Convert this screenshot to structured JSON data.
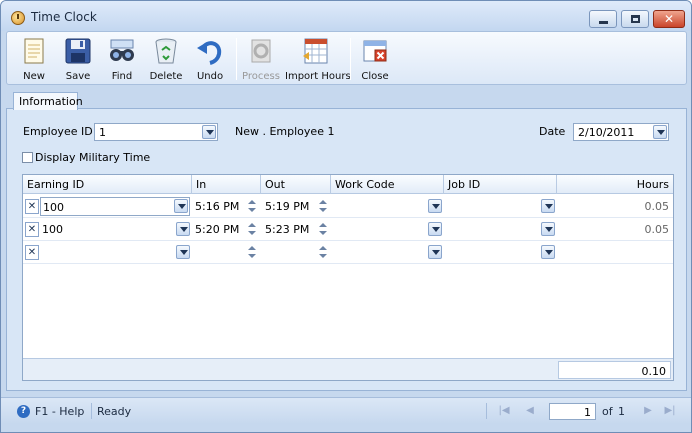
{
  "window": {
    "title": "Time Clock"
  },
  "toolbar": {
    "buttons": [
      {
        "label": "New",
        "icon": "new-document-icon"
      },
      {
        "label": "Save",
        "icon": "floppy-disk-icon"
      },
      {
        "label": "Find",
        "icon": "binoculars-icon"
      },
      {
        "label": "Delete",
        "icon": "recycle-bin-icon"
      },
      {
        "label": "Undo",
        "icon": "undo-arrow-icon"
      },
      {
        "label": "Process",
        "icon": "process-icon",
        "disabled": true
      },
      {
        "label": "Import Hours",
        "icon": "import-hours-icon"
      },
      {
        "label": "Close",
        "icon": "close-form-icon"
      }
    ]
  },
  "tabs": {
    "information": "Information"
  },
  "form": {
    "employee_id_label": "Employee ID",
    "employee_id_value": "1",
    "employee_name": "New . Employee 1",
    "date_label": "Date",
    "date_value": "2/10/2011",
    "military_time_label": "Display Military Time"
  },
  "grid": {
    "columns": [
      "Earning ID",
      "In",
      "Out",
      "Work Code",
      "Job ID",
      "Hours"
    ],
    "rows": [
      {
        "earning_id": "100",
        "in": "5:16 PM",
        "out": "5:19 PM",
        "work_code": "",
        "job_id": "",
        "hours": "0.05"
      },
      {
        "earning_id": "100",
        "in": "5:20 PM",
        "out": "5:23 PM",
        "work_code": "",
        "job_id": "",
        "hours": "0.05"
      },
      {
        "earning_id": "",
        "in": "",
        "out": "",
        "work_code": "",
        "job_id": "",
        "hours": ""
      }
    ],
    "total_hours": "0.10"
  },
  "statusbar": {
    "help": "F1 - Help",
    "status": "Ready",
    "page": "1",
    "of_label": "of",
    "page_count": "1"
  }
}
